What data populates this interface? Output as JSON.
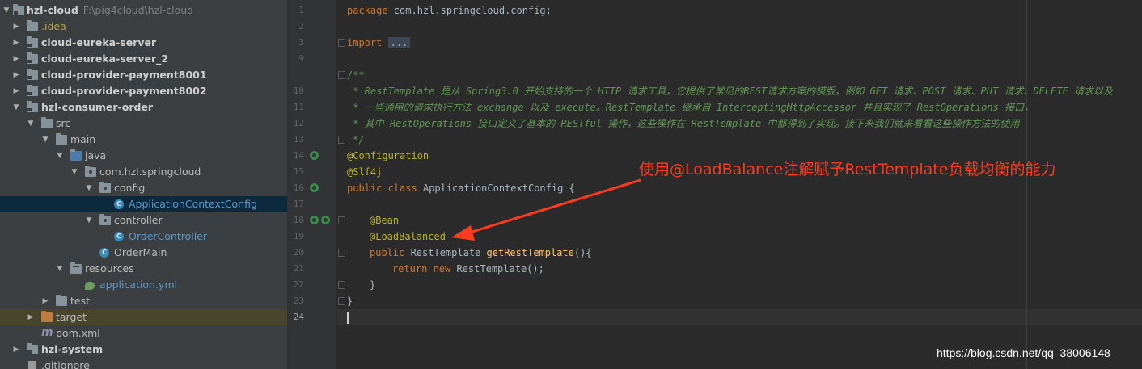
{
  "project_tree": {
    "root": {
      "name": "hzl-cloud",
      "path": "F:\\pig4cloud\\hzl-cloud"
    },
    "items": [
      {
        "label": "hzl-cloud",
        "icon": "module-folder-icon"
      },
      {
        "label": ".idea",
        "icon": "folder-icon"
      },
      {
        "label": "cloud-eureka-server",
        "icon": "module-folder-icon"
      },
      {
        "label": "cloud-eureka-server_2",
        "icon": "module-folder-icon"
      },
      {
        "label": "cloud-provider-payment8001",
        "icon": "module-folder-icon"
      },
      {
        "label": "cloud-provider-payment8002",
        "icon": "module-folder-icon"
      },
      {
        "label": "hzl-consumer-order",
        "icon": "module-folder-icon"
      },
      {
        "label": "src",
        "icon": "folder-icon"
      },
      {
        "label": "main",
        "icon": "folder-icon"
      },
      {
        "label": "java",
        "icon": "source-folder-icon"
      },
      {
        "label": "com.hzl.springcloud",
        "icon": "package-icon"
      },
      {
        "label": "config",
        "icon": "package-icon"
      },
      {
        "label": "ApplicationContextConfig",
        "icon": "class-icon"
      },
      {
        "label": "controller",
        "icon": "package-icon"
      },
      {
        "label": "OrderController",
        "icon": "class-icon"
      },
      {
        "label": "OrderMain",
        "icon": "spring-boot-class-icon"
      },
      {
        "label": "resources",
        "icon": "resources-folder-icon"
      },
      {
        "label": "application.yml",
        "icon": "yml-file-icon"
      },
      {
        "label": "test",
        "icon": "folder-icon"
      },
      {
        "label": "target",
        "icon": "excluded-folder-icon"
      },
      {
        "label": "pom.xml",
        "icon": "maven-icon"
      },
      {
        "label": "hzl-system",
        "icon": "module-folder-icon"
      },
      {
        "label": ".gitignore",
        "icon": "file-icon"
      }
    ]
  },
  "editor": {
    "line_numbers": [
      "1",
      "2",
      "3",
      "9",
      "10",
      "11",
      "12",
      "13",
      "14",
      "15",
      "16",
      "17",
      "18",
      "19",
      "20",
      "21",
      "22",
      "23",
      "24"
    ],
    "code": {
      "package_kw": "package",
      "package_name": " com.hzl.springcloud.config;",
      "import_kw": "import",
      "import_fold": "...",
      "c_open": "/**",
      "c_10": " * RestTemplate 是从 Spring3.0 开始支持的一个 HTTP 请求工具，它提供了常见的REST请求方案的模版，例如 GET 请求、POST 请求、PUT 请求、DELETE 请求以及",
      "c_11": " * 一些通用的请求执行方法 exchange 以及 execute。RestTemplate 继承自 InterceptingHttpAccessor 并且实现了 RestOperations 接口，",
      "c_12": " * 其中 RestOperations 接口定义了基本的 RESTful 操作，这些操作在 RestTemplate 中都得到了实现。接下来我们就来看看这些操作方法的使用",
      "c_close": " */",
      "ann_config": "@Configuration",
      "ann_slf4j": "@Slf4j",
      "class_kw": "public class",
      "class_rest": " ApplicationContextConfig {",
      "ann_bean": "@Bean",
      "ann_lb": "@LoadBalanced",
      "method_kw": "public",
      "method_type": " RestTemplate ",
      "method_name": "getRestTemplate",
      "method_tail": "(){",
      "return_kw": "return new",
      "return_rest": " RestTemplate();",
      "brace_inner": "}",
      "brace_outer": "}"
    }
  },
  "annotation": {
    "text": "使用@LoadBalance注解赋予RestTemplate负载均衡的能力",
    "color": "#ff3b1f"
  },
  "watermark": "https://blog.csdn.net/qq_38006148",
  "colors": {
    "keyword": "#cc7832",
    "annotation": "#bbb529",
    "comment": "#629755",
    "method": "#ffc66d",
    "text": "#a9b7c6",
    "selection": "#0d293e"
  }
}
